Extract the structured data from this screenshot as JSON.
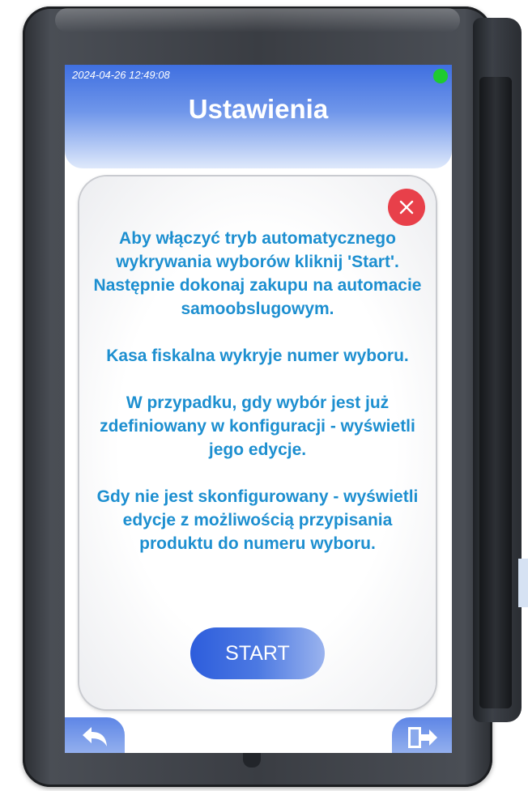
{
  "status_bar": {
    "datetime": "2024-04-26 12:49:08",
    "status_color": "#1ecb2f"
  },
  "header": {
    "title": "Ustawienia"
  },
  "dialog": {
    "close_icon": "close-icon",
    "paragraphs": [
      "Aby włączyć tryb automatycznego wykrywania wyborów kliknij 'Start'. Następnie dokonaj zakupu na automacie samoobslugowym.",
      "Kasa fiskalna wykryje numer wyboru.",
      "W przypadku, gdy wybór jest już zdefiniowany w konfiguracji - wyświetli jego edycje.",
      "Gdy nie jest skonfigurowany - wyświetli edycje z możliwością przypisania produktu do numeru wyboru."
    ],
    "start_label": "START"
  },
  "footer": {
    "back_icon": "back-arrow-icon",
    "exit_icon": "exit-door-icon"
  },
  "colors": {
    "accent": "#1d8fd0",
    "header_blue": "#3f6fe0",
    "close_red": "#e8404a"
  }
}
